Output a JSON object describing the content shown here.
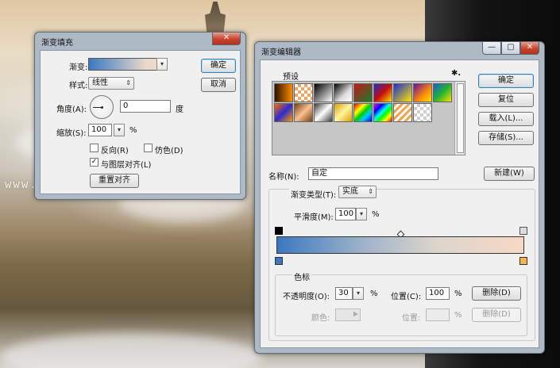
{
  "background": {
    "watermark": "www.haoyiyinshejii.com"
  },
  "fill_dialog": {
    "title": "渐变填充",
    "gradient_label": "渐变:",
    "style_label": "样式:",
    "style_value": "线性",
    "angle_label": "角度(A):",
    "angle_value": "0",
    "angle_unit": "度",
    "scale_label": "缩放(S):",
    "scale_value": "100",
    "scale_unit": "%",
    "reverse_label": "反向(R)",
    "dither_label": "仿色(D)",
    "align_label": "与图层对齐(L)",
    "align_checked": "✓",
    "reset_align_button": "重置对齐",
    "ok_button": "确定",
    "cancel_button": "取消"
  },
  "editor_dialog": {
    "title": "渐变编辑器",
    "presets_label": "预设",
    "gear_icon_glyph": "✱.",
    "ok_button": "确定",
    "reset_button": "复位",
    "load_button": "载入(L)...",
    "save_button": "存储(S)...",
    "name_label": "名称(N):",
    "name_value": "自定",
    "new_button": "新建(W)",
    "type_label": "渐变类型(T):",
    "type_value": "实底",
    "smoothness_label": "平滑度(M):",
    "smoothness_value": "100",
    "smoothness_unit": "%",
    "stops_group": "色标",
    "opacity_label": "不透明度(O):",
    "opacity_value": "30",
    "opacity_unit": "%",
    "location_label": "位置(C):",
    "location_value": "100",
    "location_unit": "%",
    "delete_button": "删除(D)",
    "color_label": "颜色:",
    "color_location_label": "位置:",
    "color_location_unit": "%",
    "color_delete_button": "删除(D)",
    "gradient_start_color": "#3b78c2",
    "gradient_end_color": "#f7d8c4"
  }
}
